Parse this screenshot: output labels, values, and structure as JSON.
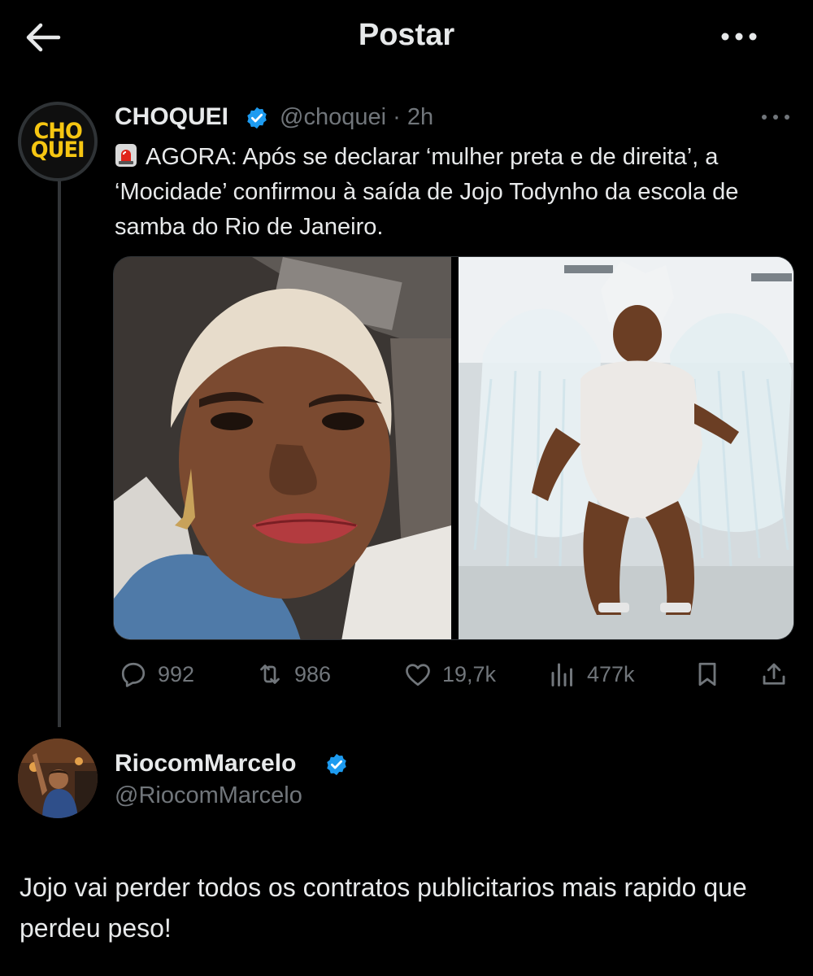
{
  "header": {
    "title": "Postar",
    "back_icon": "arrow-left-icon",
    "more_icon": "more-horizontal-icon"
  },
  "tweet": {
    "avatar_text_line1": "CHO",
    "avatar_text_line2": "QUEI",
    "display_name": "CHOQUEI",
    "handle": "@choquei",
    "separator": "·",
    "time": "2h",
    "verified": true,
    "text": "AGORA: Após se declarar ‘mulher preta e de direita’, a ‘Mocidade’ confirmou à saída de Jojo Todynho da escola de samba do Rio de Janeiro.",
    "emoji": "siren-icon",
    "media_count": 2,
    "stats": {
      "replies": "992",
      "reposts": "986",
      "likes": "19,7k",
      "views": "477k"
    }
  },
  "reply": {
    "display_name": "RiocomMarcelo",
    "handle": "@RiocomMarcelo",
    "verified": true,
    "text": "Jojo vai perder todos os contratos publicitarios  mais rapido que perdeu peso!"
  },
  "colors": {
    "background": "#000000",
    "text": "#e7e9ea",
    "secondary": "#71767b",
    "verified": "#1d9bf0",
    "brand_yellow": "#f6c612"
  }
}
